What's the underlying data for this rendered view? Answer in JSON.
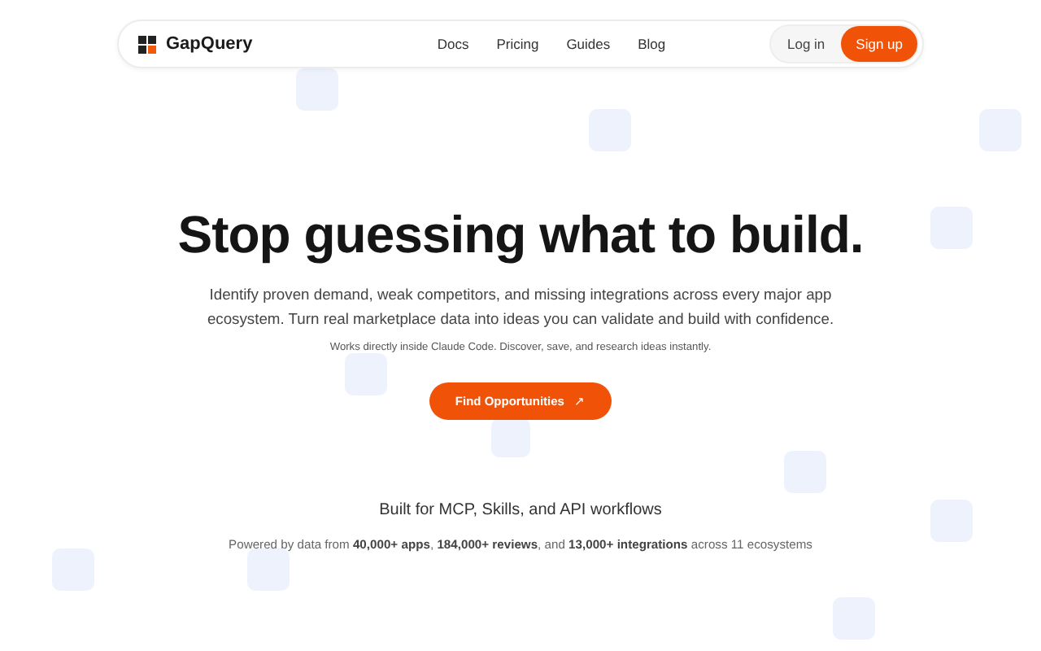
{
  "nav": {
    "brand": "GapQuery",
    "links": [
      "Docs",
      "Pricing",
      "Guides",
      "Blog"
    ],
    "login": "Log in",
    "signup": "Sign up"
  },
  "hero": {
    "title": "Stop guessing what to build.",
    "subtitle": "Identify proven demand, weak competitors, and missing integrations across every major app ecosystem. Turn real marketplace data into ideas you can validate and build with confidence.",
    "note": "Works directly inside Claude Code. Discover, save, and research ideas instantly.",
    "cta": "Find Opportunities",
    "cta_icon": "↗"
  },
  "footer": {
    "heading": "Built for MCP, Skills, and API workflows",
    "stats": "Powered by data from **40,000+ apps**, **184,000+ reviews**, and **13,000+ integrations** across 11 ecosystems"
  }
}
